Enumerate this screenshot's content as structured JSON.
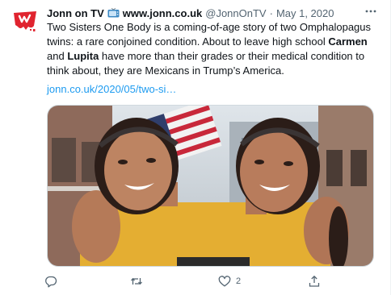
{
  "account": {
    "name": "Jonn on TV",
    "website": "www.jonn.co.uk",
    "handle": "@JonnOnTV",
    "separator": "·",
    "date": "May 1, 2020"
  },
  "tweet": {
    "text_part1": "Two Sisters One Body  is a coming-of-age story of two Omphalopagus twins: a rare conjoined condition. About to leave high school ",
    "name1": "Carmen",
    "text_part2": " and ",
    "name2": "Lupita",
    "text_part3": " have more than their grades or their medical condition to think about, they are Mexicans in Trump’s America.",
    "link": "jonn.co.uk/2020/05/two-si…"
  },
  "actions": {
    "reply_count": "",
    "retweet_count": "",
    "like_count": "2"
  },
  "icons": {
    "more": "more-icon",
    "reply": "reply-icon",
    "retweet": "retweet-icon",
    "like": "heart-icon",
    "share": "share-icon",
    "tv": "tv-emoji-icon"
  },
  "colors": {
    "link": "#1d9bf0",
    "meta": "#536471",
    "logo": "#e0242f",
    "dress": "#e7b236"
  }
}
